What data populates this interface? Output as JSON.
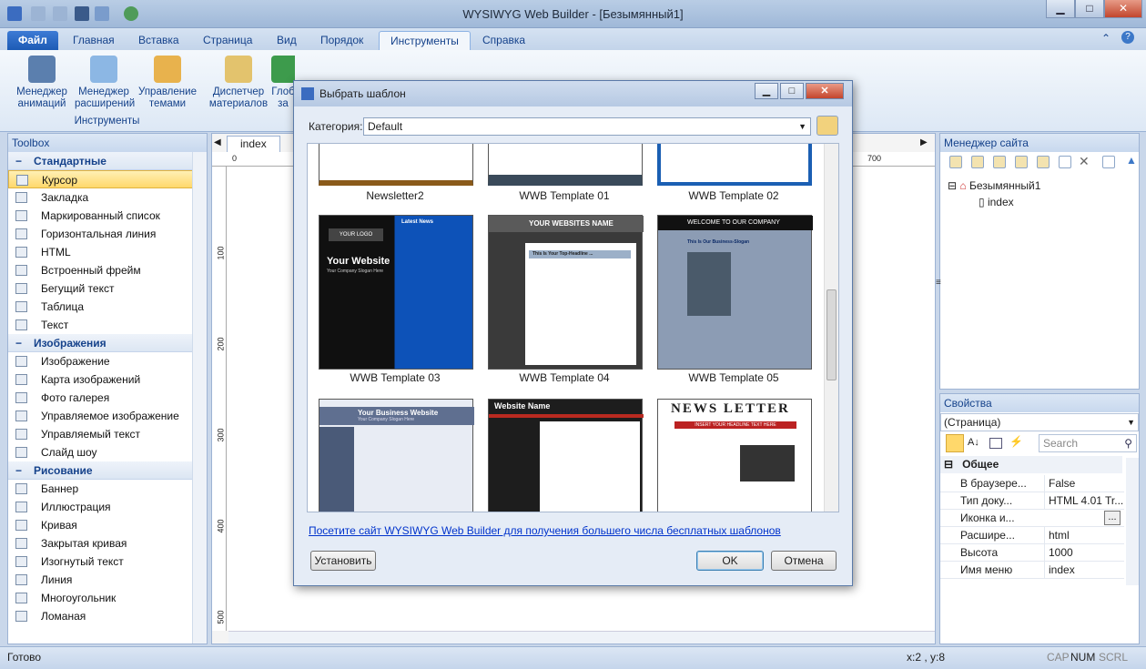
{
  "app": {
    "title": "WYSIWYG Web Builder - [Безымянный1]"
  },
  "tabs": [
    "Файл",
    "Главная",
    "Вставка",
    "Страница",
    "Вид",
    "Порядок",
    "Инструменты",
    "Справка"
  ],
  "ribbon": {
    "buttons": [
      {
        "label": "Менеджер анимаций"
      },
      {
        "label": "Менеджер расширений"
      },
      {
        "label": "Управление темами"
      },
      {
        "label": "Диспетчер материалов"
      },
      {
        "label": "Глоб за"
      }
    ],
    "group_label": "Инструменты"
  },
  "toolbox": {
    "title": "Toolbox",
    "categories": [
      {
        "name": "Стандартные",
        "items": [
          "Курсор",
          "Закладка",
          "Маркированный список",
          "Горизонтальная линия",
          "HTML",
          "Встроенный фрейм",
          "Бегущий текст",
          "Таблица",
          "Текст"
        ]
      },
      {
        "name": "Изображения",
        "items": [
          "Изображение",
          "Карта изображений",
          "Фото галерея",
          "Управляемое изображение",
          "Управляемый текст",
          "Слайд шоу"
        ]
      },
      {
        "name": "Рисование",
        "items": [
          "Баннер",
          "Иллюстрация",
          "Кривая",
          "Закрытая кривая",
          "Изогнутый текст",
          "Линия",
          "Многоугольник",
          "Ломаная"
        ]
      }
    ]
  },
  "canvas": {
    "tab": "index",
    "ruler_top": [
      "0",
      "700"
    ],
    "ruler_left": [
      "100",
      "200",
      "300",
      "400",
      "500"
    ]
  },
  "site_manager": {
    "title": "Менеджер сайта",
    "root": "Безымянный1",
    "page": "index"
  },
  "properties": {
    "title": "Свойства",
    "object": "(Страница)",
    "search_placeholder": "Search",
    "section": "Общее",
    "rows": [
      {
        "name": "В браузере...",
        "value": "False"
      },
      {
        "name": "Тип доку...",
        "value": "HTML 4.01 Tr..."
      },
      {
        "name": "Иконка и...",
        "value": ""
      },
      {
        "name": "Расшире...",
        "value": "html"
      },
      {
        "name": "Высота",
        "value": "1000"
      },
      {
        "name": "Имя меню",
        "value": "index"
      }
    ]
  },
  "status": {
    "left": "Готово",
    "coords": "x:2 , y:8",
    "caps": "CAP",
    "num": "NUM",
    "scrl": "SCRL"
  },
  "dialog": {
    "title": "Выбрать шаблон",
    "category_label": "Категория:",
    "category_value": "Default",
    "templates": [
      {
        "name": "Newsletter2"
      },
      {
        "name": "WWB Template 01"
      },
      {
        "name": "WWB Template 02"
      },
      {
        "name": "WWB Template 03",
        "header": "Your Website",
        "sub": "Your Company Slogan Here",
        "logo": "YOUR LOGO",
        "side": "Latest News"
      },
      {
        "name": "WWB Template 04",
        "header": "YOUR WEBSITES NAME",
        "headline": "This Is Your Top-Headline ..."
      },
      {
        "name": "WWB Template 05",
        "header": "WELCOME TO OUR COMPANY",
        "slogan": "This Is Our Business-Slogan"
      },
      {
        "header": "Your Business Website",
        "sub": "Your Company Slogan Here"
      },
      {
        "header": "Website Name"
      },
      {
        "header": "NEWS LETTER",
        "sub": "INSERT YOUR HEADLINE TEXT HERE"
      }
    ],
    "link": "Посетите сайт WYSIWYG Web Builder для получения большего числа бесплатных шаблонов",
    "install_button": "Установить",
    "ok_button": "OK",
    "cancel_button": "Отмена"
  }
}
